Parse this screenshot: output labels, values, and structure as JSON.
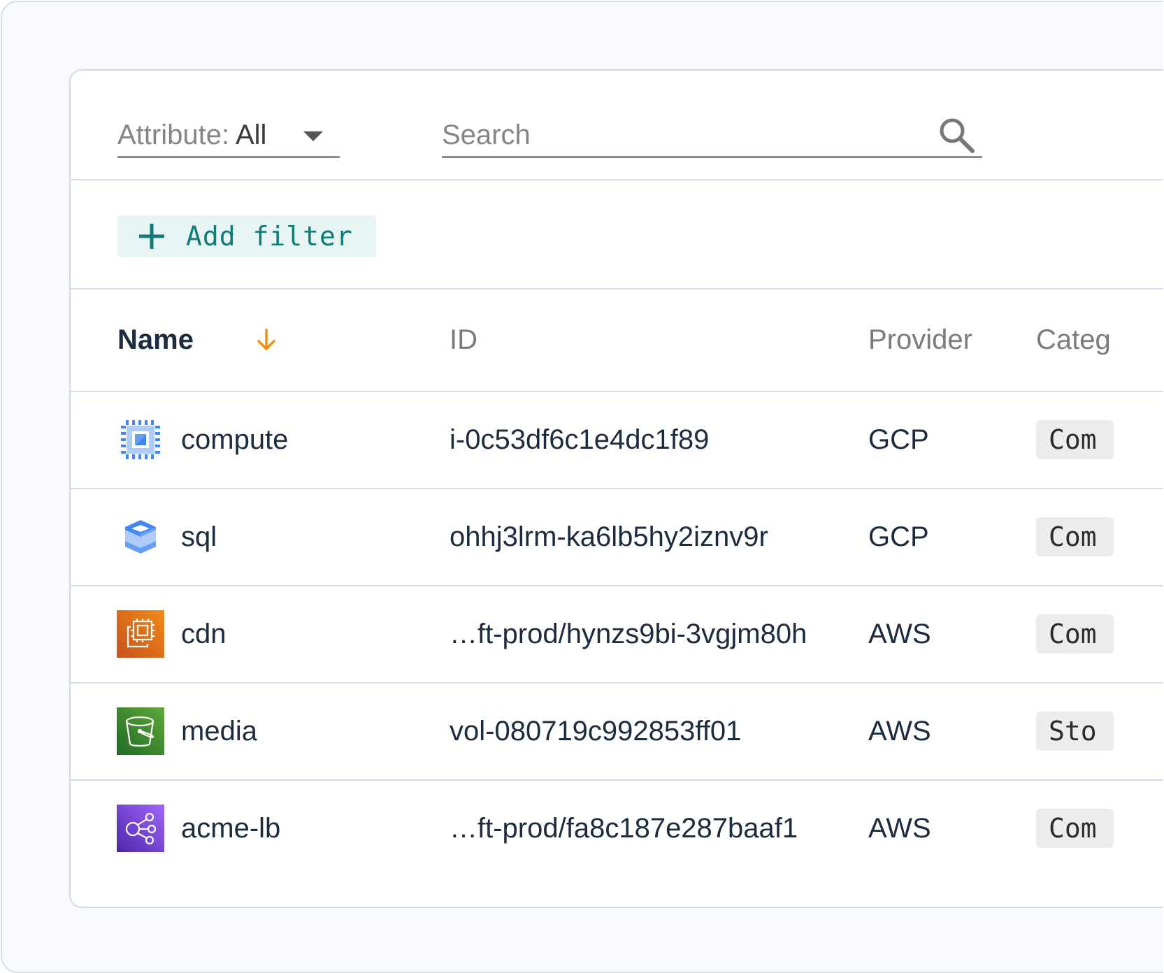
{
  "toolbar": {
    "attribute_prefix": "Attribute: ",
    "attribute_value": "All",
    "search_placeholder": "Search"
  },
  "filter_bar": {
    "add_filter_label": "Add filter"
  },
  "table": {
    "columns": {
      "name": "Name",
      "id": "ID",
      "provider": "Provider",
      "category": "Categ"
    },
    "sort": {
      "column": "name",
      "direction": "descending"
    },
    "rows": [
      {
        "icon": "gcp-compute-engine-icon",
        "name": "compute",
        "id": "i-0c53df6c1e4dc1f89",
        "provider": "GCP",
        "category": "Com"
      },
      {
        "icon": "gcp-cloud-sql-icon",
        "name": "sql",
        "id": "ohhj3lrm-ka6lb5hy2iznv9r",
        "provider": "GCP",
        "category": "Com"
      },
      {
        "icon": "aws-ec2-icon",
        "name": "cdn",
        "id": "…ft-prod/hynzs9bi-3vgjm80h",
        "provider": "AWS",
        "category": "Com"
      },
      {
        "icon": "aws-s3-bucket-icon",
        "name": "media",
        "id": "vol-080719c992853ff01",
        "provider": "AWS",
        "category": "Sto"
      },
      {
        "icon": "aws-elastic-load-balancer-icon",
        "name": "acme-lb",
        "id": "…ft-prod/fa8c187e287baaf1",
        "provider": "AWS",
        "category": "Com"
      }
    ]
  },
  "colors": {
    "accent_teal": "#137a76",
    "sort_orange": "#f0900a",
    "text_dark": "#1d2b3f",
    "aws_orange": "#e8670d",
    "aws_green": "#3f8b24",
    "aws_purple": "#7a48d8",
    "gcp_blue": "#4285f4"
  }
}
